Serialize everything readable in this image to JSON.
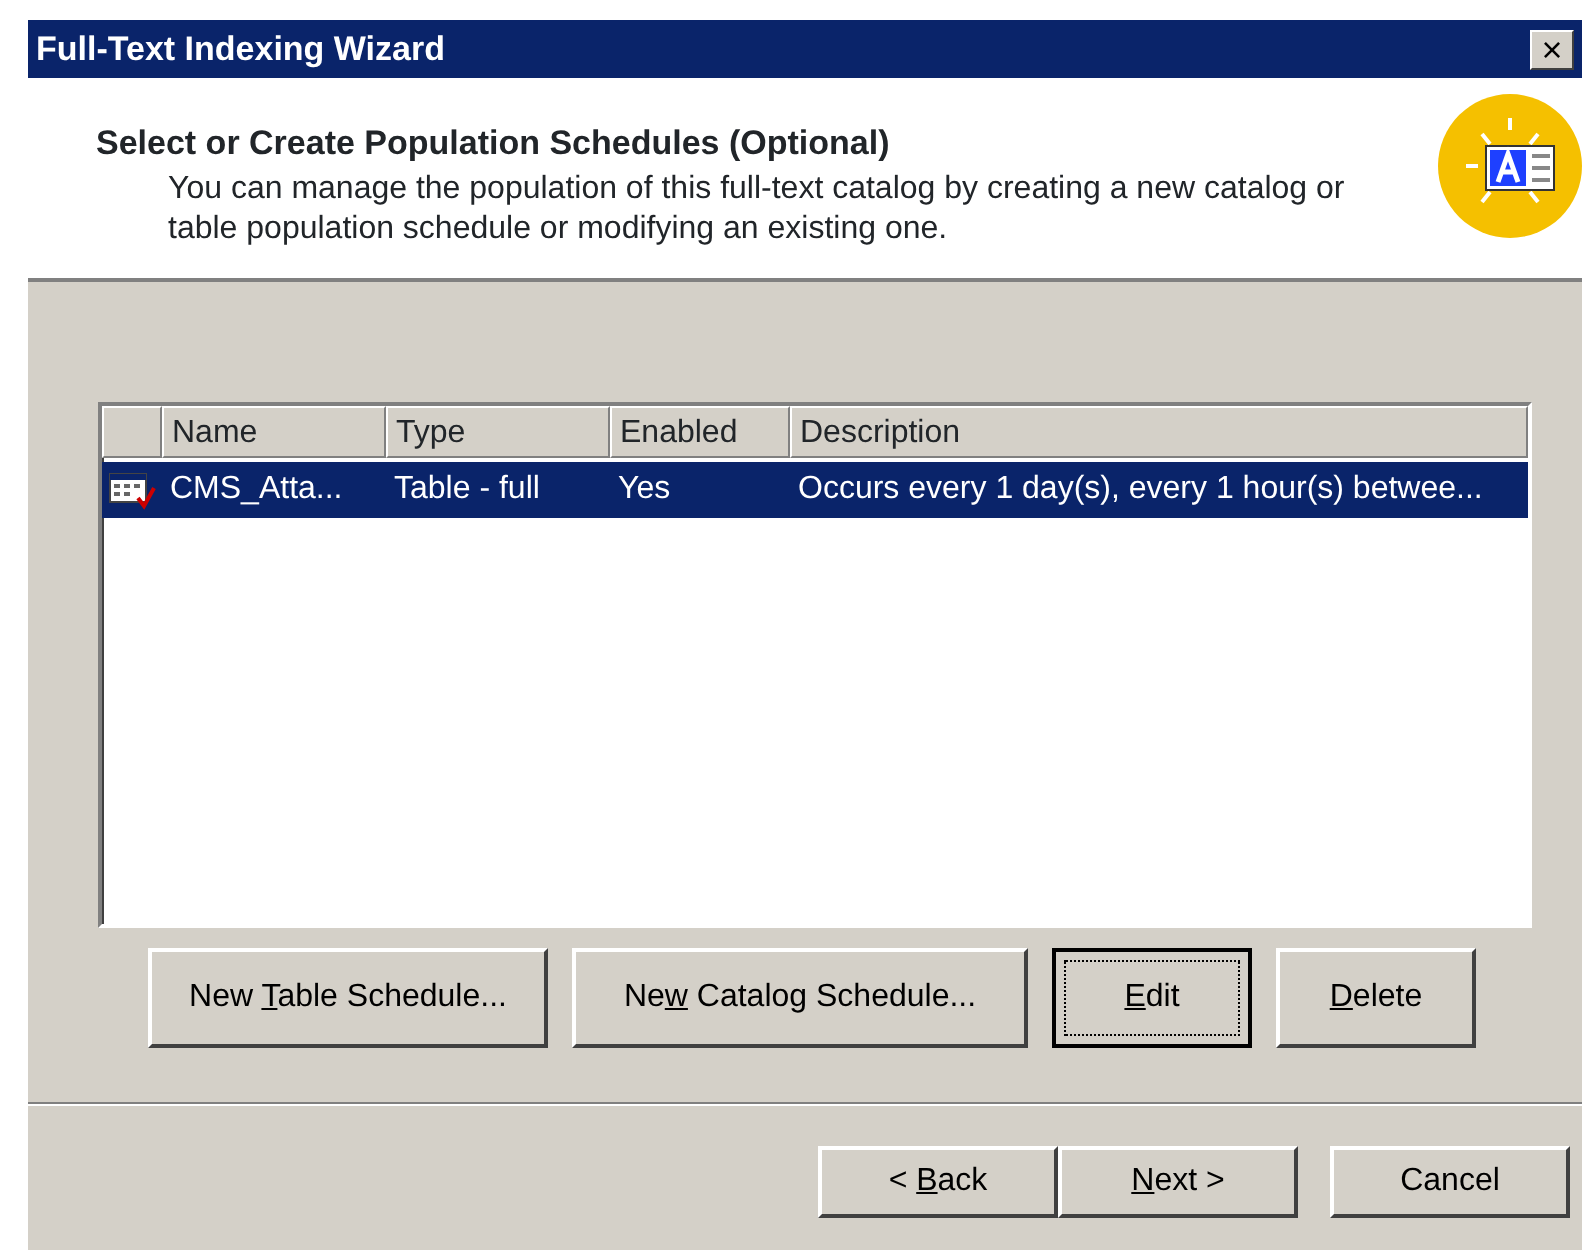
{
  "window": {
    "title": "Full-Text Indexing Wizard",
    "close": "×"
  },
  "header": {
    "title": "Select or Create Population Schedules (Optional)",
    "description": "You can manage the population of this full-text catalog by creating a new catalog or table population schedule or modifying an existing one."
  },
  "table": {
    "columns": [
      "Name",
      "Type",
      "Enabled",
      "Description"
    ],
    "rows": [
      {
        "selected": true,
        "cells": [
          "CMS_Atta...",
          "Table - full",
          "Yes",
          "Occurs every 1 day(s), every 1 hour(s) betwee..."
        ]
      }
    ]
  },
  "actions": [
    {
      "label": {
        "before": "New ",
        "key": "T",
        "after": "able Schedule..."
      },
      "focused": false
    },
    {
      "label": {
        "before": "Ne",
        "key": "w",
        "after": " Catalog Schedule..."
      },
      "focused": false
    },
    {
      "label": {
        "key": "E",
        "after": "dit"
      },
      "focused": true
    },
    {
      "label": {
        "key": "D",
        "after": "elete"
      },
      "focused": false
    }
  ],
  "navigation": [
    {
      "label": {
        "before": "< ",
        "key": "B",
        "after": "ack"
      }
    },
    {
      "label": {
        "key": "N",
        "after": "ext >"
      }
    },
    {
      "label": {
        "before": "Cancel"
      }
    }
  ]
}
